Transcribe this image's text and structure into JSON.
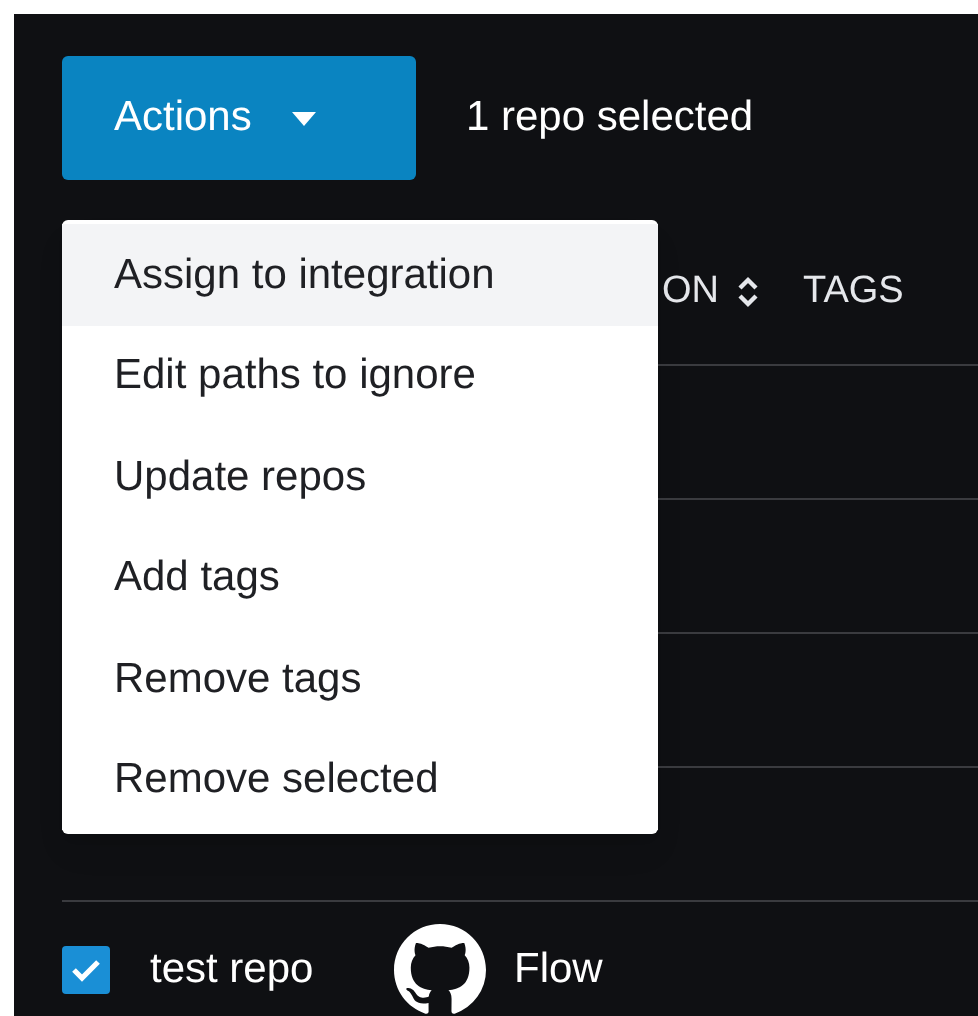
{
  "toolbar": {
    "actions_button": {
      "label": "Actions"
    },
    "selection_text": "1 repo selected"
  },
  "actions_menu": {
    "items": [
      {
        "label": "Assign to integration",
        "selected": true
      },
      {
        "label": "Edit paths to ignore",
        "selected": false
      },
      {
        "label": "Update repos",
        "selected": false
      },
      {
        "label": "Add tags",
        "selected": false
      },
      {
        "label": "Remove tags",
        "selected": false
      },
      {
        "label": "Remove selected",
        "selected": false
      }
    ]
  },
  "table": {
    "columns": [
      {
        "label": "ON",
        "sortable": true
      },
      {
        "label": "TAGS",
        "sortable": false
      }
    ],
    "rows": [
      {
        "checked": true,
        "name": "test repo",
        "integration": "Flow"
      }
    ]
  }
}
